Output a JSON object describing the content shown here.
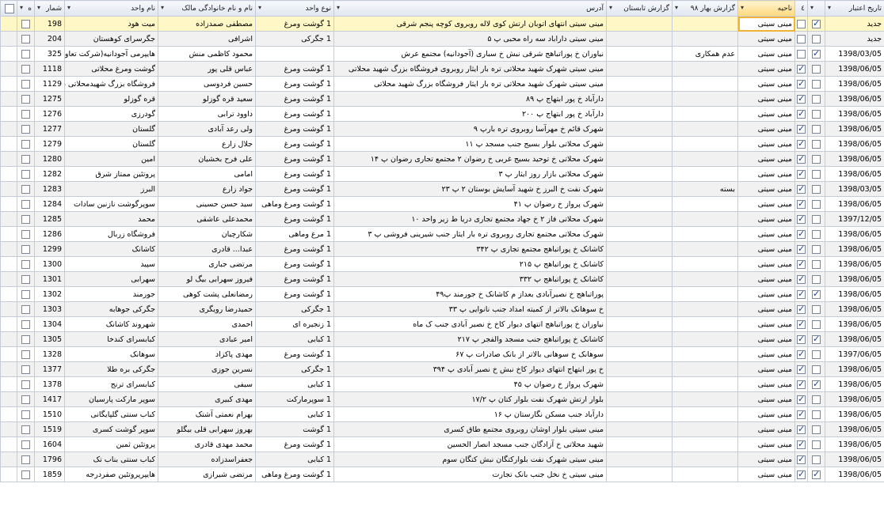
{
  "columns": [
    {
      "key": "c0",
      "label": "ه"
    },
    {
      "key": "shomar",
      "label": "شمار"
    },
    {
      "key": "unit_name",
      "label": "نام واحد"
    },
    {
      "key": "owner",
      "label": "نام و نام خانوادگی مالک"
    },
    {
      "key": "unit_type",
      "label": "نوع واحد"
    },
    {
      "key": "address",
      "label": "آدرس"
    },
    {
      "key": "summer",
      "label": "گزارش تابستان"
    },
    {
      "key": "spring",
      "label": "گزارش بهار ۹۸"
    },
    {
      "key": "district",
      "label": "ناحیه"
    },
    {
      "key": "chk2",
      "label": "٤"
    },
    {
      "key": "chk1",
      "label": ""
    },
    {
      "key": "date",
      "label": "تاریخ اعتبار"
    }
  ],
  "rows": [
    {
      "c0": false,
      "shomar": "198",
      "unit_name": "میت هود",
      "owner": "مصطفی صمدزاده",
      "type": "1 گوشت ومرغ",
      "address": "مینی سیتی انتهای اتوبان ارتش کوی لاله روبروی کوچه پنجم شرقی",
      "summer": "",
      "spring": "",
      "district": "مینی سیتی",
      "chk2": false,
      "chk1": true,
      "date": "جدید"
    },
    {
      "c0": false,
      "shomar": "204",
      "unit_name": "جگرسرای کوهستان",
      "owner": "اشرافی",
      "type": "1 جگرکی",
      "address": "مینی سیتی داراباد سه راه محبی پ ۵",
      "summer": "",
      "spring": "",
      "district": "مینی سیتی",
      "chk2": false,
      "chk1": false,
      "date": "جدید"
    },
    {
      "c0": false,
      "shomar": "325",
      "unit_name": "هایپرمی آجودانیه(شرکت تعاونی",
      "owner": "محمود کاظمی منش",
      "type": "",
      "address": "نیاوران خ پوراتباهج شرقی نبش خ سباری (آجودانیه) مجتمع عرش",
      "summer": "",
      "spring": "عدم همکاری",
      "district": "مینی سیتی",
      "chk2": false,
      "chk1": true,
      "date": "1398/03/05"
    },
    {
      "c0": false,
      "shomar": "1118",
      "unit_name": "گوشت ومرغ محلاتی",
      "owner": "عباس قلی پور",
      "type": "1 گوشت ومرغ",
      "address": "مینی سیتی شهرک شهید محلاتی تره بار ایثار روبروی فروشگاه بزرگ شهید محلاتی",
      "summer": "",
      "spring": "",
      "district": "مینی سیتی",
      "chk2": true,
      "chk1": false,
      "date": "1398/06/05"
    },
    {
      "c0": false,
      "shomar": "1129",
      "unit_name": "فروشگاه بزرگ شهیدمحلاتی غر",
      "owner": "حسین فردوسی",
      "type": "1 گوشت ومرغ",
      "address": "مینی سیتی شهرک شهید محلاتی تره بار ایثار فروشگاه بزرگ شهید محلاتی",
      "summer": "",
      "spring": "",
      "district": "مینی سیتی",
      "chk2": true,
      "chk1": false,
      "date": "1398/06/05"
    },
    {
      "c0": false,
      "shomar": "1275",
      "unit_name": "قره گوزلو",
      "owner": "سعید قره گوزلو",
      "type": "1 گوشت ومرغ",
      "address": "دارآباد خ پور ابتهاج پ ۸۹",
      "summer": "",
      "spring": "",
      "district": "مینی سیتی",
      "chk2": true,
      "chk1": false,
      "date": "1398/06/05"
    },
    {
      "c0": false,
      "shomar": "1276",
      "unit_name": "گودرزی",
      "owner": "داوود ترابی",
      "type": "1 گوشت ومرغ",
      "address": "دارآباد خ پور ابتهاج پ ۲۰۰",
      "summer": "",
      "spring": "",
      "district": "مینی سیتی",
      "chk2": true,
      "chk1": false,
      "date": "1398/06/05"
    },
    {
      "c0": false,
      "shomar": "1277",
      "unit_name": "گلستان",
      "owner": "ولی رعد آبادی",
      "type": "1 گوشت ومرغ",
      "address": "شهرک قائم خ مهرآسا روبروی تره بارپ ۹",
      "summer": "",
      "spring": "",
      "district": "مینی سیتی",
      "chk2": true,
      "chk1": false,
      "date": "1398/06/05"
    },
    {
      "c0": false,
      "shomar": "1279",
      "unit_name": "گلستان",
      "owner": "جلال زارع",
      "type": "1 گوشت ومرغ",
      "address": "شهرک محلاتی بلوار بسیج جنب مسجد پ ۱۱",
      "summer": "",
      "spring": "",
      "district": "مینی سیتی",
      "chk2": true,
      "chk1": false,
      "date": "1398/06/05"
    },
    {
      "c0": false,
      "shomar": "1280",
      "unit_name": "امین",
      "owner": "علی فرح بخشیان",
      "type": "1 گوشت ومرغ",
      "address": "شهرک محلاتی خ توحید بسیج غربی خ رضوان ۲ مجتمع تجاری رضوان پ ۱۴",
      "summer": "",
      "spring": "",
      "district": "مینی سیتی",
      "chk2": true,
      "chk1": false,
      "date": "1398/06/05"
    },
    {
      "c0": false,
      "shomar": "1282",
      "unit_name": "پروتئین ممتاز شرق",
      "owner": "امامی",
      "type": "1 گوشت ومرغ",
      "address": "شهرک محلاتی بازار روز ایثار پ ۳",
      "summer": "",
      "spring": "",
      "district": "مینی سیتی",
      "chk2": true,
      "chk1": false,
      "date": "1398/06/05"
    },
    {
      "c0": false,
      "shomar": "1283",
      "unit_name": "البرز",
      "owner": "جواد زارع",
      "type": "1 گوشت ومرغ",
      "address": "شهرک نفت خ البرز خ شهید آسایش بوستان ۲ پ ۲۳",
      "summer": "",
      "spring": "بسته",
      "district": "مینی سیتی",
      "chk2": true,
      "chk1": false,
      "date": "1398/03/05"
    },
    {
      "c0": false,
      "shomar": "1284",
      "unit_name": "سوپرگوشت نازنین سادات",
      "owner": "سید حسن حسینی",
      "type": "1 گوشت ومرغ وماهی",
      "address": "شهرک پرواز خ رضوان پ ۴۱",
      "summer": "",
      "spring": "",
      "district": "مینی سیتی",
      "chk2": true,
      "chk1": false,
      "date": "1398/06/05"
    },
    {
      "c0": false,
      "shomar": "1285",
      "unit_name": "محمد",
      "owner": "محمدعلی عاشقی",
      "type": "1 گوشت ومرغ",
      "address": "شهرک محلاتی فاز ۲ خ جهاد مجتمع تجاری دریا ط زیر واحد ۱۰",
      "summer": "",
      "spring": "",
      "district": "مینی سیتی",
      "chk2": true,
      "chk1": false,
      "date": "1397/12/05"
    },
    {
      "c0": false,
      "shomar": "1286",
      "unit_name": "فروشگاه زربال",
      "owner": "شکارچیان",
      "type": "1 مرغ وماهی",
      "address": "شهرک محلاتی مجتمع تجاری روبروی تره بار ایثار جنب شیرینی فروشی پ ۳",
      "summer": "",
      "spring": "",
      "district": "مینی سیتی",
      "chk2": true,
      "chk1": false,
      "date": "1398/06/05"
    },
    {
      "c0": false,
      "shomar": "1299",
      "unit_name": "کاشانک",
      "owner": "عبدا... قادری",
      "type": "1 گوشت ومرغ",
      "address": "کاشانک خ پوراتباهج مجتمع تجاری پ ۳۴۲",
      "summer": "",
      "spring": "",
      "district": "مینی سیتی",
      "chk2": true,
      "chk1": false,
      "date": "1398/06/05"
    },
    {
      "c0": false,
      "shomar": "1300",
      "unit_name": "سپید",
      "owner": "مرتضی جباری",
      "type": "1 گوشت ومرغ",
      "address": "کاشانک خ پوراتباهج پ ۲۱۵",
      "summer": "",
      "spring": "",
      "district": "مینی سیتی",
      "chk2": true,
      "chk1": false,
      "date": "1398/06/05"
    },
    {
      "c0": false,
      "shomar": "1301",
      "unit_name": "سهرابی",
      "owner": "فیروز سهرابی بیگ لو",
      "type": "1 گوشت ومرغ",
      "address": "کاشانک خ پوراتباهج پ ۳۳۲",
      "summer": "",
      "spring": "",
      "district": "مینی سیتی",
      "chk2": true,
      "chk1": false,
      "date": "1398/06/05"
    },
    {
      "c0": false,
      "shomar": "1302",
      "unit_name": "جورمند",
      "owner": "رمضانعلی پشت کوهی",
      "type": "1 گوشت ومرغ",
      "address": "پوراتباهج خ نصیرآبادی بعداز م کاشانک خ جورمند پ۴۹",
      "summer": "",
      "spring": "",
      "district": "مینی سیتی",
      "chk2": true,
      "chk1": true,
      "date": "1398/06/05"
    },
    {
      "c0": false,
      "shomar": "1303",
      "unit_name": "جگرکی جوهابه",
      "owner": "حمیدرضا رویگری",
      "type": "1 جگرکی",
      "address": "خ سوهانک بالاتر از کمیته امداد جنب نانوایی پ ۳۳",
      "summer": "",
      "spring": "",
      "district": "مینی سیتی",
      "chk2": true,
      "chk1": false,
      "date": "1398/06/05"
    },
    {
      "c0": false,
      "shomar": "1304",
      "unit_name": "شهروند کاشانک",
      "owner": "احمدی",
      "type": "1 زنجیره ای",
      "address": "نیاوران خ پوراتباهج انتهای دیوار کاخ خ نصیر آبادی جنب ک ماه",
      "summer": "",
      "spring": "",
      "district": "مینی سیتی",
      "chk2": true,
      "chk1": false,
      "date": "1398/06/05"
    },
    {
      "c0": false,
      "shomar": "1305",
      "unit_name": "کبابسرای کندخا",
      "owner": "امیر عبادی",
      "type": "1 کبابی",
      "address": "کاشانک خ پوراتباهج جنب مسجد والفجر پ ۲۱۷",
      "summer": "",
      "spring": "",
      "district": "مینی سیتی",
      "chk2": true,
      "chk1": true,
      "date": "1398/06/05"
    },
    {
      "c0": false,
      "shomar": "1328",
      "unit_name": "سوهانک",
      "owner": "مهدی پاکزاد",
      "type": "1 گوشت ومرغ",
      "address": "سوهانک خ سوهانی بالاتر از بانک صادرات پ ۶۷",
      "summer": "",
      "spring": "",
      "district": "مینی سیتی",
      "chk2": true,
      "chk1": false,
      "date": "1397/06/05"
    },
    {
      "c0": false,
      "shomar": "1377",
      "unit_name": "جگرکی بره طلا",
      "owner": "نسرین جوزی",
      "type": "1 جگرکی",
      "address": "خ پور ابتهاج انتهای دیوار کاخ نبش خ نصیر آبادی پ ۳۹۴",
      "summer": "",
      "spring": "",
      "district": "مینی سیتی",
      "chk2": true,
      "chk1": false,
      "date": "1398/06/05"
    },
    {
      "c0": false,
      "shomar": "1378",
      "unit_name": "کبابسرای ترنج",
      "owner": "سیفی",
      "type": "1 کبابی",
      "address": "شهرک پرواز خ رضوان پ ۴۵",
      "summer": "",
      "spring": "",
      "district": "مینی سیتی",
      "chk2": true,
      "chk1": true,
      "date": "1398/06/05"
    },
    {
      "c0": false,
      "shomar": "1417",
      "unit_name": "سوپر مارکت پارسیان",
      "owner": "مهدی کبیری",
      "type": "1 سوپرمارکت",
      "address": "بلوار ارتش شهرک نفت بلوار کتان پ ۱۷/۲",
      "summer": "",
      "spring": "",
      "district": "مینی سیتی",
      "chk2": true,
      "chk1": false,
      "date": "1398/06/05"
    },
    {
      "c0": false,
      "shomar": "1510",
      "unit_name": "کباب سنتی گلپایگانی",
      "owner": "بهرام نعمتی آشتک",
      "type": "1 کبابی",
      "address": "دارآباد جنب مسکن نگارستان پ ۱۶",
      "summer": "",
      "spring": "",
      "district": "مینی سیتی",
      "chk2": true,
      "chk1": false,
      "date": "1398/06/05"
    },
    {
      "c0": false,
      "shomar": "1519",
      "unit_name": "سوپر گوشت کسری",
      "owner": "بهروز سهرابی قلی بیگلو",
      "type": "1 گوشت",
      "address": "مینی سیتی بلوار اوشان روبروی مجتمع طاق کسری",
      "summer": "",
      "spring": "",
      "district": "مینی سیتی",
      "chk2": true,
      "chk1": false,
      "date": "1398/06/05"
    },
    {
      "c0": false,
      "shomar": "1604",
      "unit_name": "پروتئین ثمین",
      "owner": "محمد مهدی قادری",
      "type": "1 گوشت ومرغ",
      "address": "شهید محلاتی خ آزادگان جنب مسجد انصار الحسین",
      "summer": "",
      "spring": "",
      "district": "مینی سیتی",
      "chk2": true,
      "chk1": false,
      "date": "1398/06/05"
    },
    {
      "c0": false,
      "shomar": "1796",
      "unit_name": "کباب سنتی بناب تک",
      "owner": "جعفراسدزاده",
      "type": "1 کبابی",
      "address": "مینی سیتی شهرک نفت بلوارکتگان نبش کتگان سوم",
      "summer": "",
      "spring": "",
      "district": "مینی سیتی",
      "chk2": true,
      "chk1": false,
      "date": "1398/06/05"
    },
    {
      "c0": false,
      "shomar": "1859",
      "unit_name": "هایپرپروتئین صفردرجه",
      "owner": "مرتضی شیرازی",
      "type": "1 گوشت ومرغ وماهی",
      "address": "مینی سیتی خ نخل جنب بانک تجارت",
      "summer": "",
      "spring": "",
      "district": "مینی سیتی",
      "chk2": true,
      "chk1": true,
      "date": "1398/06/05"
    }
  ]
}
